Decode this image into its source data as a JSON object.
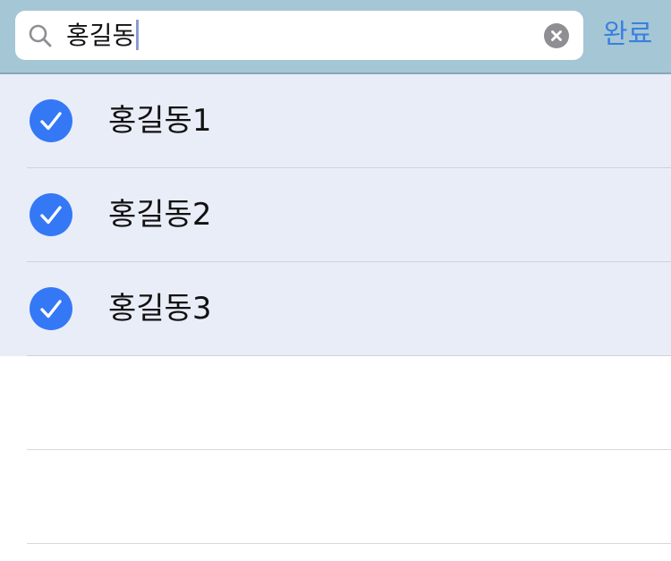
{
  "search": {
    "query": "홍길동",
    "clear_icon": "clear-circle-icon",
    "search_icon": "magnifier-icon",
    "done_label": "완료"
  },
  "results": [
    {
      "label": "홍길동1",
      "selected": true,
      "icon": "checkmark-circle-icon"
    },
    {
      "label": "홍길동2",
      "selected": true,
      "icon": "checkmark-circle-icon"
    },
    {
      "label": "홍길동3",
      "selected": true,
      "icon": "checkmark-circle-icon"
    }
  ],
  "colors": {
    "search_bar_bg": "#a5c6d4",
    "accent": "#3478f6",
    "done_text": "#3a7fe0",
    "selected_row_bg": "#e9edf8"
  }
}
